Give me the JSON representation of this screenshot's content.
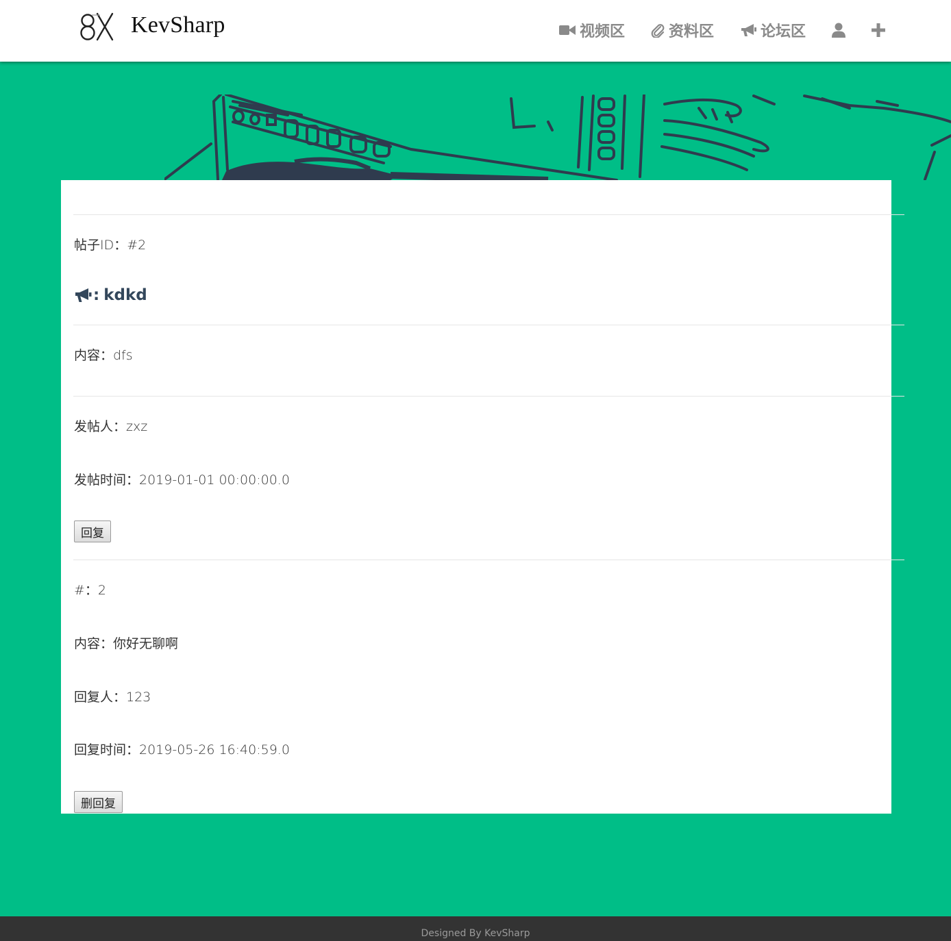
{
  "header": {
    "brand": "KevSharp",
    "nav": [
      {
        "label": "视频区",
        "icon": "video-camera-icon"
      },
      {
        "label": "资料区",
        "icon": "paperclip-icon"
      },
      {
        "label": "论坛区",
        "icon": "bullhorn-icon"
      },
      {
        "label": "",
        "icon": "user-icon"
      },
      {
        "label": "",
        "icon": "plus-icon"
      }
    ]
  },
  "post": {
    "id_label": "帖子ID：#2",
    "title_icon": "bullhorn-icon",
    "title_colon": ":",
    "title": "kdkd",
    "content": "内容：dfs",
    "author": "发帖人：zxz",
    "time": "发帖时间：2019-01-01 00:00:00.0",
    "reply_button": "回复"
  },
  "reply": {
    "number": "#：2",
    "content": "内容：你好无聊啊",
    "author": "回复人：123",
    "time": "回复时间：2019-05-26 16:40:59.0",
    "delete_button": "删回复"
  },
  "footer": {
    "text": "Designed By KevSharp"
  },
  "colors": {
    "background": "#00be87",
    "card": "#ffffff",
    "footer": "#333333",
    "nav_text": "#8a8a8a",
    "title": "#33475b"
  }
}
